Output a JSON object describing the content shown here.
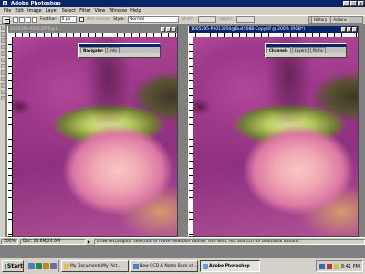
{
  "app": {
    "title": "Adobe Photoshop"
  },
  "menu": [
    "File",
    "Edit",
    "Image",
    "Layer",
    "Select",
    "Filter",
    "View",
    "Window",
    "Help"
  ],
  "options": {
    "feather_label": "Feather:",
    "feather_value": "0 px",
    "antialiased_label": "Anti-aliased",
    "style_label": "Style:",
    "style_value": "Normal",
    "width_label": "Width:",
    "height_label": "Height:"
  },
  "palette_well": {
    "tabs": [
      "History",
      "Actions"
    ]
  },
  "documents": [
    {
      "title": "1005295-P5013950@1...",
      "active": false
    },
    {
      "title": "1005295-P5013950@Bu4508B-Copy.tif @ 200% (RGB*)",
      "active": true
    }
  ],
  "palettes": {
    "navigator": {
      "tabs": [
        "Navigator",
        "Info"
      ]
    },
    "channels": {
      "tabs": [
        "Channels",
        "Layers",
        "Paths"
      ]
    }
  },
  "status": {
    "zoom": "200%",
    "doc_size": "Doc: 24.6M/24.6M",
    "hint": "Draw rectangular selection or move selection outline. Use Shift, Alt, and Ctrl for additional options."
  },
  "taskbar": {
    "start": "Start",
    "tasks": [
      {
        "label": "My Documents\\My Pict...",
        "active": false
      },
      {
        "label": "New CCD & Notes Back sh...",
        "active": false
      },
      {
        "label": "Adobe Photoshop",
        "active": true
      }
    ],
    "clock": "8:41 PM"
  },
  "colors": {
    "titlebar": "#0a246a",
    "chrome": "#d4d0c8",
    "petal_magenta": "#a03b8a",
    "stamen_pink": "#f0a7b3",
    "stem_green": "#b9ca5e"
  }
}
